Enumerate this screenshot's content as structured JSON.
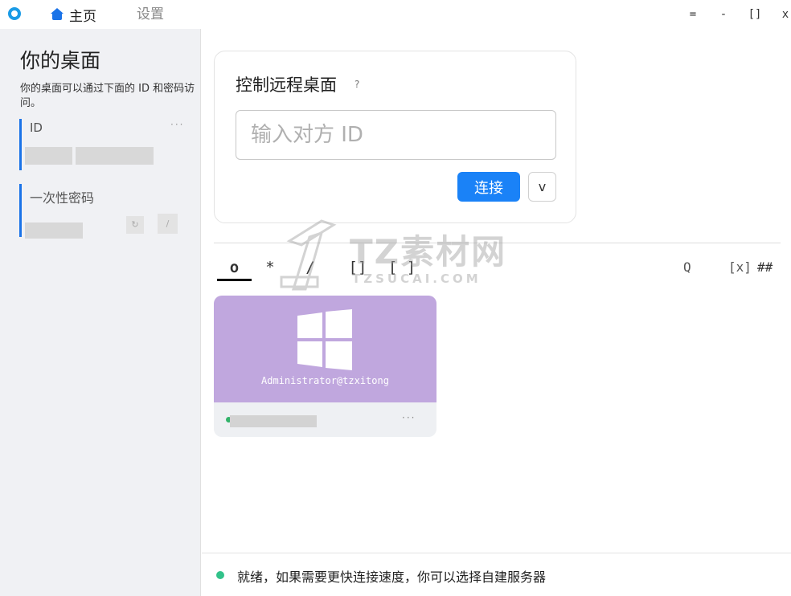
{
  "titlebar": {
    "tab_home": "主页",
    "tab_settings": "设置",
    "menu_btn": "=",
    "minimize_btn": "-",
    "maximize_btn": "[]",
    "close_btn": "x"
  },
  "sidebar": {
    "title": "你的桌面",
    "description": "你的桌面可以通过下面的 ID 和密码访问。",
    "id_label": "ID",
    "id_menu": "···",
    "password_label": "一次性密码",
    "refresh_btn": "↻",
    "edit_btn": "/"
  },
  "control": {
    "title": "控制远程桌面",
    "help": "?",
    "id_placeholder": "输入对方 ID",
    "connect_label": "连接",
    "more_label": "v"
  },
  "peer_tabs": {
    "recent": "o",
    "favorites": "*",
    "discovered": "/",
    "address_book": "[]",
    "group": "[ ]",
    "search": "Q",
    "view_toggle": "[x]",
    "sort": "##"
  },
  "peers": [
    {
      "user": "Administrator@tzxitong",
      "menu": "···",
      "online": true
    }
  ],
  "status": {
    "text": "就绪，如果需要更快连接速度，你可以选择自建服务器"
  },
  "watermark": {
    "text": "TZ素材网",
    "sub": "TZSUCAI.COM"
  },
  "colors": {
    "accent": "#1a82f7",
    "online": "#32c28a",
    "thumb": "#c0a7de"
  }
}
